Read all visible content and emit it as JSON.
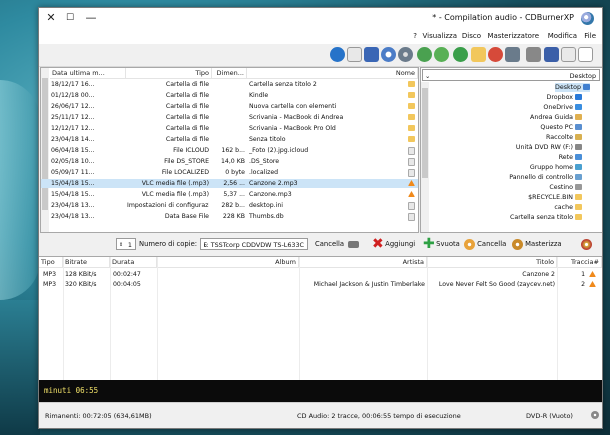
{
  "window": {
    "title": "* - Compilation audio - CDBurnerXP"
  },
  "menu": [
    "File",
    "Modifica",
    "Masterizzatore",
    "Disco",
    "Visualizza",
    "?"
  ],
  "files": {
    "headers": {
      "name": "Nome",
      "size": "Dimen...",
      "type": "Tipo",
      "modified": "Data ultima m..."
    },
    "rows": [
      {
        "name": "Cartella senza titolo 2",
        "size": "",
        "type": "Cartella di file",
        "modified": "18/12/17 16..."
      },
      {
        "name": "Kindle",
        "size": "",
        "type": "Cartella di file",
        "modified": "01/12/18 00..."
      },
      {
        "name": "Nuova cartella con elementi",
        "size": "",
        "type": "Cartella di file",
        "modified": "26/06/17 12..."
      },
      {
        "name": "Scrivania - MacBook di Andrea",
        "size": "",
        "type": "Cartella di file",
        "modified": "25/11/17 12..."
      },
      {
        "name": "Scrivania - MacBook Pro Old",
        "size": "",
        "type": "Cartella di file",
        "modified": "12/12/17 12..."
      },
      {
        "name": "Senza titolo",
        "size": "",
        "type": "Cartella di file",
        "modified": "23/04/18 14..."
      },
      {
        "name": "_Foto (2).jpg.icloud",
        "size": "162 b...",
        "type": "File ICLOUD",
        "modified": "06/04/18 15..."
      },
      {
        "name": ".DS_Store",
        "size": "14,0 KB",
        "type": "File DS_STORE",
        "modified": "02/05/18 10..."
      },
      {
        "name": ".localized",
        "size": "0 byte",
        "type": "File LOCALIZED",
        "modified": "05/09/17 11..."
      },
      {
        "name": "Canzone 2.mp3",
        "size": "2,56 ...",
        "type": "VLC media file (.mp3)",
        "modified": "15/04/18 15..."
      },
      {
        "name": "Canzone.mp3",
        "size": "5,37 ...",
        "type": "VLC media file (.mp3)",
        "modified": "15/04/18 15..."
      },
      {
        "name": "desktop.ini",
        "size": "282 b...",
        "type": "Impostazioni di configurazio...",
        "modified": "23/04/18 13..."
      },
      {
        "name": "Thumbs.db",
        "size": "228 KB",
        "type": "Data Base File",
        "modified": "23/04/18 13..."
      }
    ]
  },
  "tree": [
    "Desktop",
    "Desktop",
    "Dropbox",
    "OneDrive",
    "Andrea Guida",
    "Questo PC",
    "Raccolte",
    "Unità DVD RW (F:)",
    "Rete",
    "Gruppo home",
    "Pannello di controllo",
    "Cestino",
    "$RECYCLE.BIN",
    "cache",
    "Cartella senza titolo"
  ],
  "actions": {
    "copies_label": "Numero di copie:",
    "copies_value": "1",
    "drive": "F: TSSTcorp CDDVDW TS-L633C",
    "delete": "Cancella",
    "add": "Aggiungi",
    "clear": "Svuota",
    "erase": "Cancella",
    "burn": "Masterizza"
  },
  "tracks": {
    "headers": {
      "num": "Traccia#",
      "title": "Titolo",
      "artist": "Artista",
      "album": "Album",
      "duration": "Durata",
      "bitrate": "Bitrate",
      "type": "Tipo"
    },
    "rows": [
      {
        "num": "1",
        "title": "Canzone 2",
        "artist": "",
        "album": "",
        "duration": "00:02:47",
        "bitrate": "128 KBit/s",
        "type": "MP3"
      },
      {
        "num": "2",
        "title": "Love Never Felt So Good (zaycev.net)",
        "artist": "Michael Jackson & Justin Timberlake",
        "album": "",
        "duration": "00:04:05",
        "bitrate": "320 KBit/s",
        "type": "MP3"
      }
    ]
  },
  "capacity": {
    "label": "minuti 06:55"
  },
  "status": {
    "drive": "DVD-R (Vuoto)",
    "info": "CD Audio: 2 tracce, 00:06:55 tempo di esecuzione",
    "remaining": "Rimanenti: 00:72:05 (634,61MB)"
  }
}
